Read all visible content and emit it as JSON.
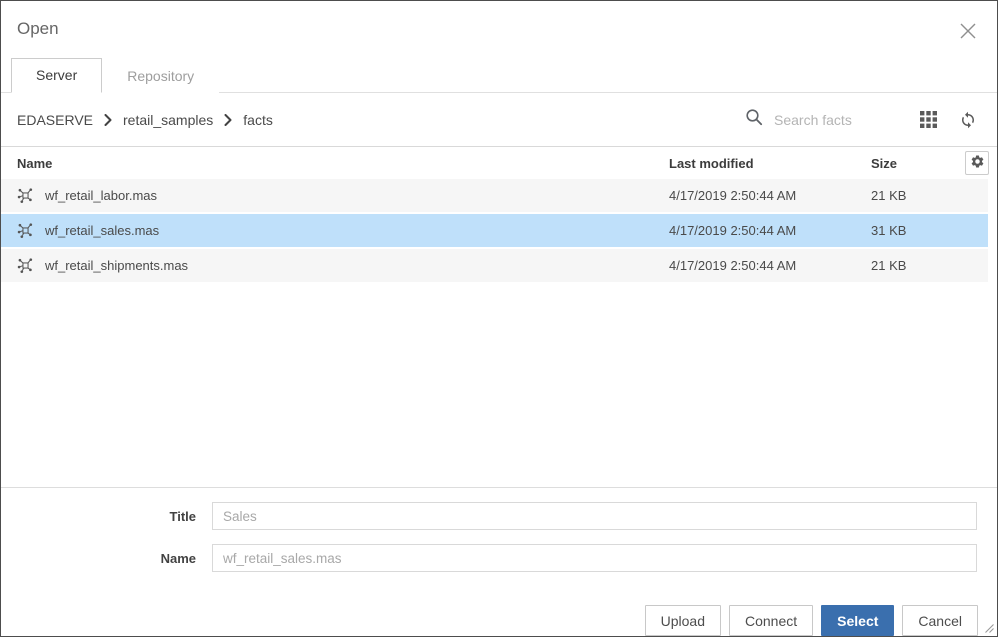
{
  "dialog": {
    "title": "Open"
  },
  "tabs": {
    "server": "Server",
    "repository": "Repository"
  },
  "breadcrumb": {
    "items": [
      "EDASERVE",
      "retail_samples",
      "facts"
    ]
  },
  "toolbar": {
    "search_placeholder": "Search facts"
  },
  "table": {
    "columns": {
      "name": "Name",
      "modified": "Last modified",
      "size": "Size"
    },
    "rows": [
      {
        "name": "wf_retail_labor.mas",
        "modified": "4/17/2019 2:50:44 AM",
        "size": "21 KB",
        "selected": false
      },
      {
        "name": "wf_retail_sales.mas",
        "modified": "4/17/2019 2:50:44 AM",
        "size": "31 KB",
        "selected": true
      },
      {
        "name": "wf_retail_shipments.mas",
        "modified": "4/17/2019 2:50:44 AM",
        "size": "21 KB",
        "selected": false
      }
    ]
  },
  "form": {
    "title_label": "Title",
    "title_placeholder": "Sales",
    "name_label": "Name",
    "name_placeholder": "wf_retail_sales.mas"
  },
  "footer": {
    "upload": "Upload",
    "connect": "Connect",
    "select": "Select",
    "cancel": "Cancel"
  },
  "colors": {
    "selected_row_bg": "#bfe0fa",
    "primary_button_bg": "#3a6fae",
    "row_bg": "#f6f6f6",
    "icon_gray": "#5a5a5a"
  }
}
